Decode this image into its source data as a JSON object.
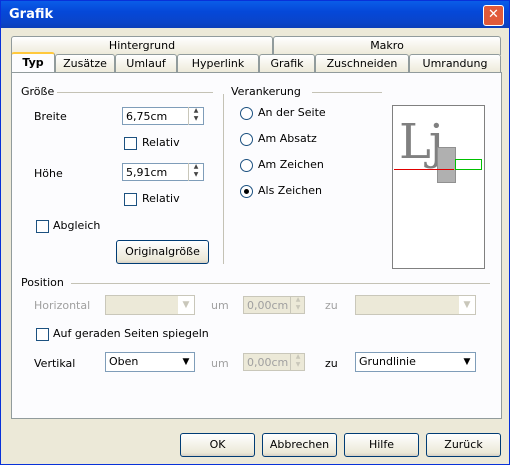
{
  "window": {
    "title": "Grafik"
  },
  "tabs": {
    "row1": [
      "Hintergrund",
      "Makro"
    ],
    "row2": [
      "Typ",
      "Zusätze",
      "Umlauf",
      "Hyperlink",
      "Grafik",
      "Zuschneiden",
      "Umrandung"
    ]
  },
  "groesse": {
    "label": "Größe",
    "breite_label": "Breite",
    "breite_value": "6,75cm",
    "relativ1": "Relativ",
    "hoehe_label": "Höhe",
    "hoehe_value": "5,91cm",
    "relativ2": "Relativ",
    "abgleich": "Abgleich",
    "original_button": "Originalgröße"
  },
  "verankerung": {
    "label": "Verankerung",
    "options": [
      "An der Seite",
      "Am Absatz",
      "Am Zeichen",
      "Als Zeichen"
    ],
    "selected": "Als Zeichen"
  },
  "preview": {
    "letters": "Lj"
  },
  "position": {
    "label": "Position",
    "horizontal_label": "Horizontal",
    "um1": "um",
    "um1_value": "0,00cm",
    "zu1": "zu",
    "spiegeln": "Auf geraden Seiten spiegeln",
    "vertikal_label": "Vertikal",
    "vertikal_value": "Oben",
    "um2": "um",
    "um2_value": "0,00cm",
    "zu2": "zu",
    "zu2_value": "Grundlinie"
  },
  "buttons": {
    "ok": "OK",
    "cancel": "Abbrechen",
    "help": "Hilfe",
    "back": "Zurück"
  }
}
